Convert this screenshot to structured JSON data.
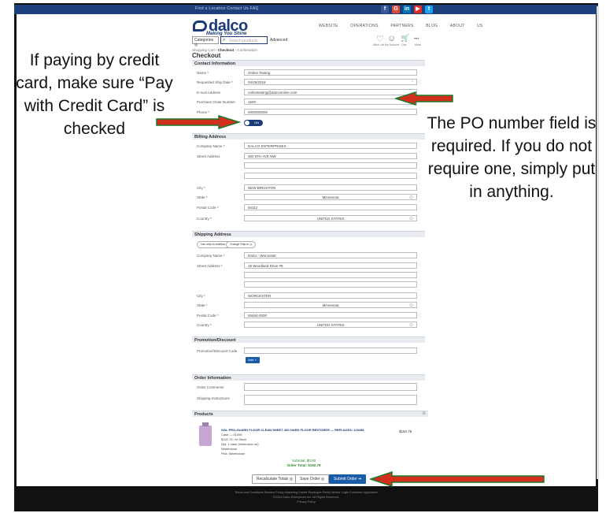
{
  "topbar": {
    "links": "Find a Location   Contact Us   FAQ",
    "social": [
      {
        "glyph": "f",
        "color": "#3b5998"
      },
      {
        "glyph": "G",
        "color": "#dd4b39"
      },
      {
        "glyph": "in",
        "color": "#0077b5"
      },
      {
        "glyph": "▶",
        "color": "#e52d27"
      },
      {
        "glyph": "t",
        "color": "#1da1f2"
      }
    ]
  },
  "header": {
    "logo": "dalco",
    "tagline": "Making You Shine",
    "nav": "WEBSITE  OPERATIONS  PARTNERS  BLOG  ABOUT US",
    "category_btn": "Categories",
    "search_placeholder": "Search products",
    "advanced": "Advanced",
    "icons": [
      {
        "glyph": "♡",
        "label": "Wish List"
      },
      {
        "glyph": "☺",
        "label": "My Account"
      },
      {
        "glyph": "🛒",
        "label": "Cart"
      },
      {
        "glyph": "•••",
        "label": "More"
      }
    ]
  },
  "breadcrumb": {
    "prefix": "Shopping Cart ›",
    "current": "Checkout",
    "suffix": "› Confirmation"
  },
  "page_title": "Checkout",
  "contact": {
    "header": "Contact Information",
    "fields": [
      {
        "label": "Name *",
        "value": "Online Testing"
      },
      {
        "label": "Requested Ship Date *",
        "value": "04/25/2018"
      },
      {
        "label": "E-mail Address",
        "value": "onlinetesting@dalcoonline.com"
      },
      {
        "label": "Purchase Order Number",
        "value": "1600"
      },
      {
        "label": "Phone *",
        "value": "0000000000"
      }
    ],
    "toggle_label": "Pay with Credit Card",
    "toggle_state": "ON"
  },
  "billing": {
    "header": "Billing Address",
    "company_label": "Company Name *",
    "company_value": "DALCO ENTERPRISES",
    "street_label": "Street Address",
    "street_value": "300 5TH AVE NW",
    "city_label": "City *",
    "city_value": "NEW BRIGHTON",
    "state_label": "State *",
    "state_value": "Minnesota",
    "zip_label": "Postal Code *",
    "zip_value": "55112",
    "country_label": "Country *",
    "country_value": "UNITED STATES"
  },
  "shipping": {
    "header": "Shipping Address",
    "btn1": "Use ship-to address",
    "btn2": "Change Ship-to",
    "company_label": "Company Name *",
    "company_value": "Dalco - Worcester",
    "street_label": "Street Address *",
    "street_value": "18 Woodland Drive #8",
    "city_label": "City *",
    "city_value": "WORCESTER",
    "state_label": "State *",
    "state_value": "Minnesota",
    "zip_label": "Postal Code *",
    "zip_value": "55464-0000",
    "country_label": "Country *",
    "country_value": "UNITED STATES"
  },
  "promotion": {
    "header": "Promotion/Discount",
    "label": "Promotion/Discount Code",
    "apply": "Add ✓"
  },
  "order_info": {
    "header": "Order Information",
    "comments_label": "Order Comments",
    "shipping_label": "Shipping Instructions"
  },
  "products": {
    "header": "Products",
    "item": {
      "name": "GAL PRO-GUARD FLOOR CLEAN SHEET 40X HARD FLOOR RESTORER — REPLACES: 123456",
      "lines": [
        "Case — 01490",
        "$192.79 / In Stock",
        "Qty: 1 case (dimension ok)",
        "Warehouse",
        "Pick: Warehouse"
      ],
      "price": "$192.79"
    },
    "subtotal": "Subtotal: $0.00",
    "order_total": "Order Total: $192.79",
    "recalc_btn": "Recalculate Totals",
    "save_btn": "Save Order",
    "submit_btn": "Submit Order"
  },
  "footer": {
    "line1": "Terms and Conditions   Returns Policy   Marketing Center   Employee Portal   Vendor Login   Customer Application",
    "line2": "©2018 Dalco Enterprises Inc. All Rights Reserved.",
    "line3": "Privacy Policy"
  },
  "annotations": {
    "left": "If paying by credit card, make sure “Pay with Credit Card” is checked",
    "right": "The PO number field is required. If you do not require one, simply put in anything.",
    "arrow_color": "#d32f1f",
    "arrow_border": "#1a7a2a"
  }
}
